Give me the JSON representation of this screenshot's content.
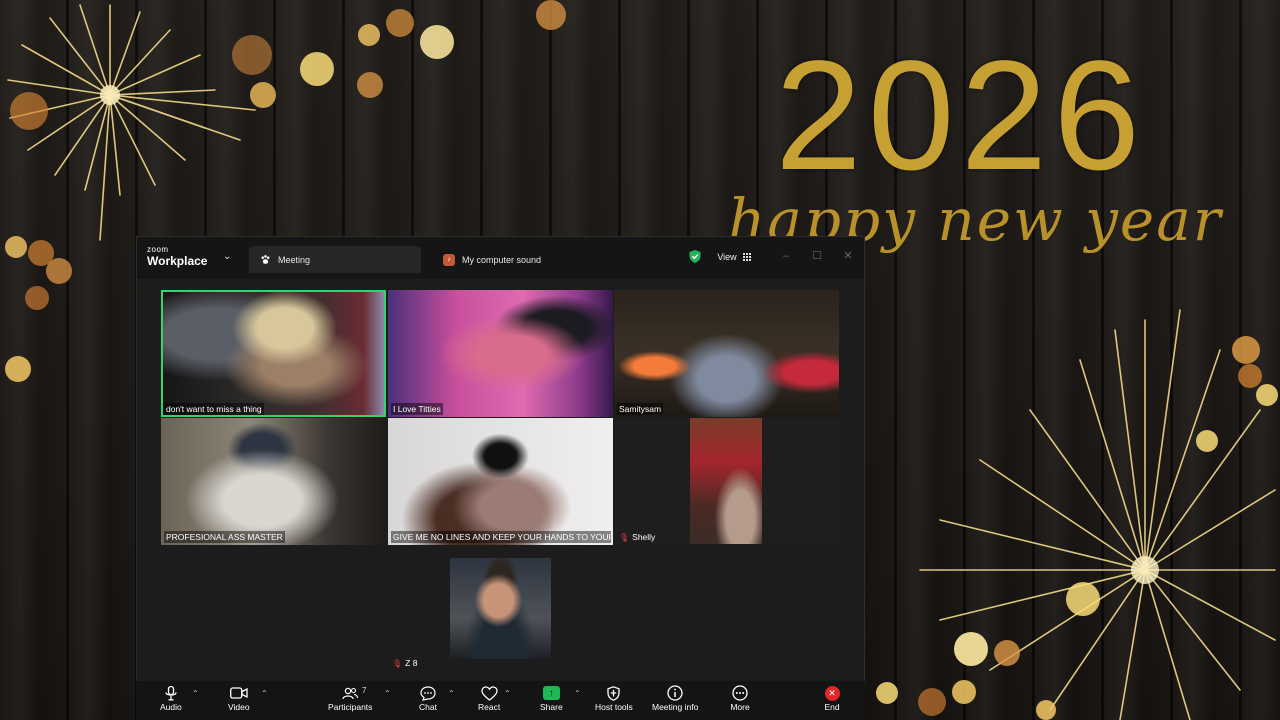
{
  "wallpaper": {
    "year": "2026",
    "greeting": "happy new year",
    "accent_color": "#c6a033"
  },
  "window": {
    "brand_small": "zoom",
    "brand_big": "Workplace",
    "tabs": [
      {
        "label": "Meeting",
        "icon": "paw-icon"
      },
      {
        "label": "My computer sound",
        "icon": "sound-icon"
      }
    ],
    "view_label": "View",
    "active_speaker_color": "#35d36b"
  },
  "participants": [
    {
      "name": "don't want to miss a thing",
      "active": true,
      "muted": false
    },
    {
      "name": "I Love Titties",
      "active": false,
      "muted": false
    },
    {
      "name": "Samitysam",
      "active": false,
      "muted": false
    },
    {
      "name": "PROFESIONAL ASS MASTER",
      "active": false,
      "muted": false
    },
    {
      "name": "GIVE ME NO LINES AND KEEP YOUR HANDS TO YOUR...",
      "active": false,
      "muted": false
    },
    {
      "name": "Shelly",
      "active": false,
      "muted": true
    },
    {
      "name": "Z 8",
      "active": false,
      "muted": true
    }
  ],
  "toolbar": {
    "audio": "Audio",
    "video": "Video",
    "participants": "Participants",
    "participants_count": "7",
    "chat": "Chat",
    "react": "React",
    "share": "Share",
    "host_tools": "Host tools",
    "meeting_info": "Meeting info",
    "more": "More",
    "end": "End",
    "share_color": "#1db954",
    "end_color": "#e02828"
  }
}
